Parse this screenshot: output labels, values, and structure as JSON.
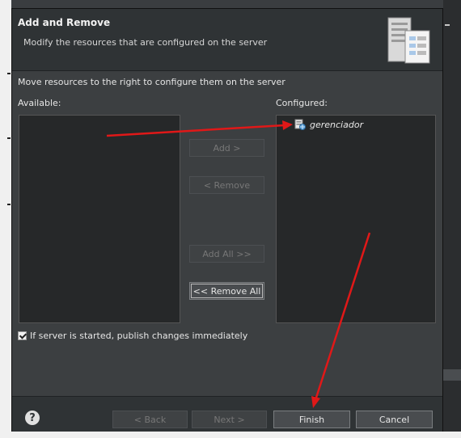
{
  "header": {
    "title": "Add and Remove",
    "subtitle": "Modify the resources that are configured on the server"
  },
  "instructions": "Move resources to the right to configure them on the server",
  "lists": {
    "available_label": "Available:",
    "configured_label": "Configured:",
    "configured_items": [
      {
        "label": "gerenciador",
        "icon": "web-module-icon"
      }
    ]
  },
  "buttons": {
    "add": "Add >",
    "remove": "< Remove",
    "add_all": "Add All >>",
    "remove_all": "<< Remove All"
  },
  "options": {
    "publish_label": "If server is started, publish changes immediately",
    "publish_checked": true
  },
  "footer": {
    "help": "?",
    "back": "< Back",
    "next": "Next >",
    "finish": "Finish",
    "cancel": "Cancel"
  },
  "colors": {
    "dialog_bg": "#3c3f41",
    "list_bg": "#262829",
    "annotation_arrow": "#e01818"
  }
}
